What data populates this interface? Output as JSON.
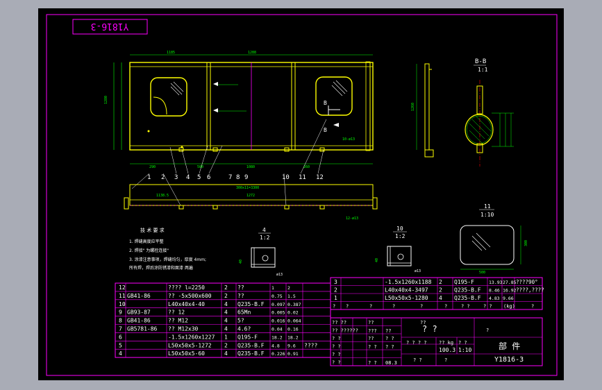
{
  "colors": {
    "background": "#000000",
    "frame": "#ff00ff",
    "outer_bg": "#a9acb6",
    "line_main": "#ffff00",
    "line_alt": "#ffffff",
    "dim": "#00ff00",
    "hatch": "#00ff00",
    "centerline": "#ff0000",
    "detail": "#ffffff"
  },
  "stamp": "Y1816-3",
  "views": {
    "section_bb": {
      "title": "B-B",
      "scale": "1:1"
    },
    "detail_11": {
      "title": "11",
      "scale": "1:10"
    },
    "detail_4": {
      "title": "4",
      "scale": "1:2"
    },
    "detail_10": {
      "title": "10",
      "scale": "1:2"
    }
  },
  "dims": {
    "top_total": "1185",
    "mid_span": "1288",
    "pitch": "500",
    "left_gap": "290",
    "bottom_span": "1080",
    "right_span": "260",
    "top_flange": "300x11=3300",
    "flange_len": "1272",
    "flange_left": "1138.5",
    "bolt_note": "12-ø13",
    "hole_note": "10-ø13",
    "view_h": "1280",
    "side_h": "1260",
    "d11_h": "300",
    "d11_w": "500",
    "d4_w": "40",
    "d10_w": "40",
    "holes4": "ø13",
    "holes10": "ø13"
  },
  "callouts": [
    "1",
    "2",
    "3",
    "4",
    "5",
    "6",
    "7",
    "8",
    "9",
    "10",
    "11",
    "12"
  ],
  "section_marks": [
    "B",
    "B"
  ],
  "tech_req": {
    "title": "技 术 要 求",
    "lines": [
      "1. 焊缝高度应平整",
      "2. 焊接\" 为螺栓连接\"",
      "3. 涂漆注意事项，焊缝均匀，厚度 4mm;",
      "   所有焊，焊后涂防锈漆和面漆 两遍"
    ]
  },
  "bom_left": [
    {
      "no": "12",
      "code": "",
      "name": "???? l=2250",
      "qty": "2",
      "mat": "??",
      "w1": "1",
      "w2": "2",
      "note": ""
    },
    {
      "no": "11",
      "code": "GB41-86",
      "name": "?? -5x500x600",
      "qty": "2",
      "mat": "??",
      "w1": "0.75",
      "w2": "1.5",
      "note": ""
    },
    {
      "no": "10",
      "code": "",
      "name": "L40x40x4-40",
      "qty": "4",
      "mat": "Q235-B.F",
      "w1": "0.097",
      "w2": "0.387",
      "note": ""
    },
    {
      "no": "9",
      "code": "GB93-87",
      "name": "?? 12",
      "qty": "4",
      "mat": "65Mn",
      "w1": "0.005",
      "w2": "0.02",
      "note": ""
    },
    {
      "no": "8",
      "code": "GB41-86",
      "name": "?? M12",
      "qty": "4",
      "mat": "5?",
      "w1": "0.016",
      "w2": "0.064",
      "note": ""
    },
    {
      "no": "7",
      "code": "GB5781-86",
      "name": "?? M12x30",
      "qty": "4",
      "mat": "4.6?",
      "w1": "0.04",
      "w2": "0.16",
      "note": ""
    },
    {
      "no": "6",
      "code": "",
      "name": "-1.5x1260x1227",
      "qty": "1",
      "mat": "Q195-F",
      "w1": "18.2",
      "w2": "18.2",
      "note": ""
    },
    {
      "no": "5",
      "code": "",
      "name": "L50x50x5-1272",
      "qty": "2",
      "mat": "Q235-B.F",
      "w1": "4.8",
      "w2": "9.6",
      "note": "????"
    },
    {
      "no": "4",
      "code": "",
      "name": "L50x50x5-60",
      "qty": "4",
      "mat": "Q235-B.F",
      "w1": "0.226",
      "w2": "0.91",
      "note": ""
    }
  ],
  "bom_right": [
    {
      "no": "3",
      "name": "-1.5x1260x1188",
      "qty": "2",
      "mat": "Q195-F",
      "w1": "13.93",
      "w2": "27.85",
      "note": "????90°"
    },
    {
      "no": "2",
      "name": "L40x40x4-3497",
      "qty": "2",
      "mat": "Q235-B.F",
      "w1": "8.46",
      "w2": "16.92",
      "note": "????,????"
    },
    {
      "no": "1",
      "name": "L50x50x5-1280",
      "qty": "4",
      "mat": "Q235-B.F",
      "w1": "4.83",
      "w2": "9.66",
      "note": ""
    }
  ],
  "bom_header": [
    "?",
    "?",
    "?",
    "?",
    "?",
    "?",
    "? ?",
    "? ?",
    "(kg)",
    "?"
  ],
  "title_block": {
    "drawing_name": "? ?",
    "category": "部 件",
    "drawing_no": "Y1816-3",
    "weight": "100.3",
    "scale": "1:10",
    "weight_label": "?? kg",
    "scale_label": "? ?",
    "sheet": "08.3",
    "row_labels": [
      "?? ??",
      "?? ??????",
      "? ?",
      "? ?",
      "? ?",
      "? ?"
    ],
    "qmarks": [
      "??",
      "???",
      "??",
      "? ?",
      "? ? ? ?",
      "? ?",
      "??",
      "?",
      "??",
      "? ?",
      "? ?",
      "? ?",
      "?"
    ]
  }
}
